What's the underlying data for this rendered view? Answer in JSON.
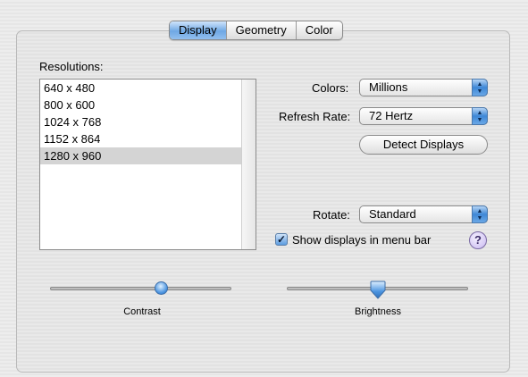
{
  "tabs": [
    {
      "label": "Display",
      "active": true
    },
    {
      "label": "Geometry",
      "active": false
    },
    {
      "label": "Color",
      "active": false
    }
  ],
  "resolutions": {
    "label": "Resolutions:",
    "items": [
      "640 x 480",
      "800 x 600",
      "1024 x 768",
      "1152 x 864",
      "1280 x 960"
    ],
    "selected": "1280 x 960"
  },
  "colors": {
    "label": "Colors:",
    "value": "Millions"
  },
  "refresh_rate": {
    "label": "Refresh Rate:",
    "value": "72 Hertz"
  },
  "detect_button": "Detect Displays",
  "rotate": {
    "label": "Rotate:",
    "value": "Standard"
  },
  "show_in_menu_bar": {
    "label": "Show displays in menu bar",
    "checked": true
  },
  "help_label": "?",
  "contrast": {
    "label": "Contrast",
    "level": 0.62
  },
  "brightness": {
    "label": "Brightness",
    "level": 0.5
  },
  "accent_color": "#4b94e0"
}
